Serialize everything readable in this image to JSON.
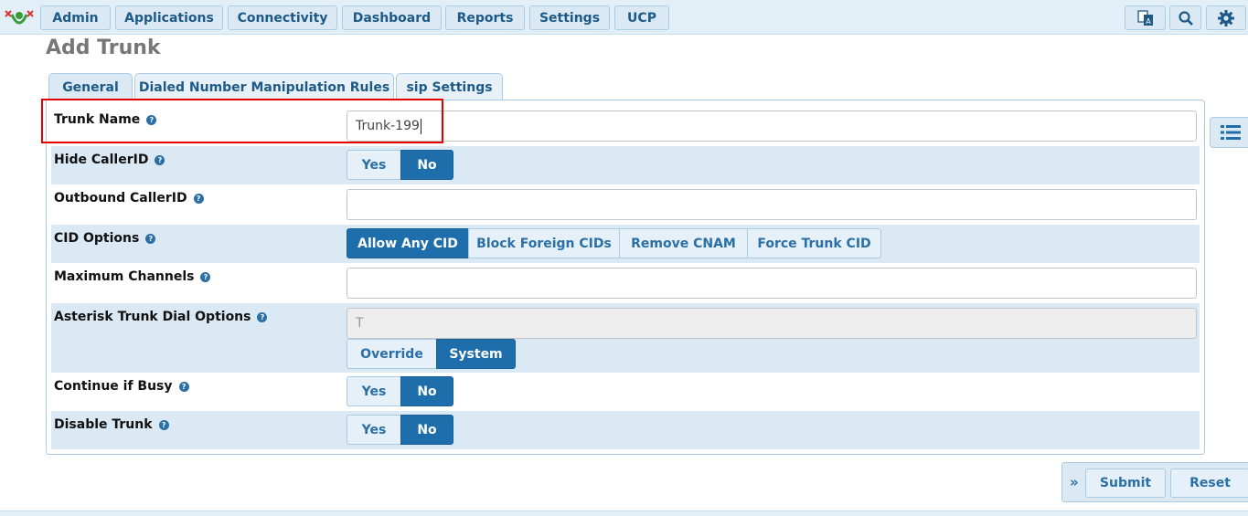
{
  "nav": {
    "items": [
      "Admin",
      "Applications",
      "Connectivity",
      "Dashboard",
      "Reports",
      "Settings",
      "UCP"
    ],
    "icons": [
      "translate-icon",
      "search-icon",
      "gear-icon"
    ],
    "accent": "#1f6eac"
  },
  "page": {
    "title": "Add Trunk"
  },
  "tabs": [
    "General",
    "Dialed Number Manipulation Rules",
    "sip Settings"
  ],
  "form": {
    "trunk_name": {
      "label": "Trunk Name",
      "value": "Trunk-199"
    },
    "hide_callerid": {
      "label": "Hide CallerID",
      "yes": "Yes",
      "no": "No",
      "selected": "No"
    },
    "outbound_callerid": {
      "label": "Outbound CallerID",
      "value": ""
    },
    "cid_options": {
      "label": "CID Options",
      "options": [
        "Allow Any CID",
        "Block Foreign CIDs",
        "Remove CNAM",
        "Force Trunk CID"
      ],
      "selected": "Allow Any CID"
    },
    "max_channels": {
      "label": "Maximum Channels",
      "value": ""
    },
    "dial_options": {
      "label": "Asterisk Trunk Dial Options",
      "placeholder": "T",
      "override": "Override",
      "system": "System",
      "selected": "System"
    },
    "continue_busy": {
      "label": "Continue if Busy",
      "yes": "Yes",
      "no": "No",
      "selected": "No"
    },
    "disable_trunk": {
      "label": "Disable Trunk",
      "yes": "Yes",
      "no": "No",
      "selected": "No"
    }
  },
  "footer": {
    "expand": "»",
    "submit": "Submit",
    "reset": "Reset"
  },
  "help_glyph": "?"
}
